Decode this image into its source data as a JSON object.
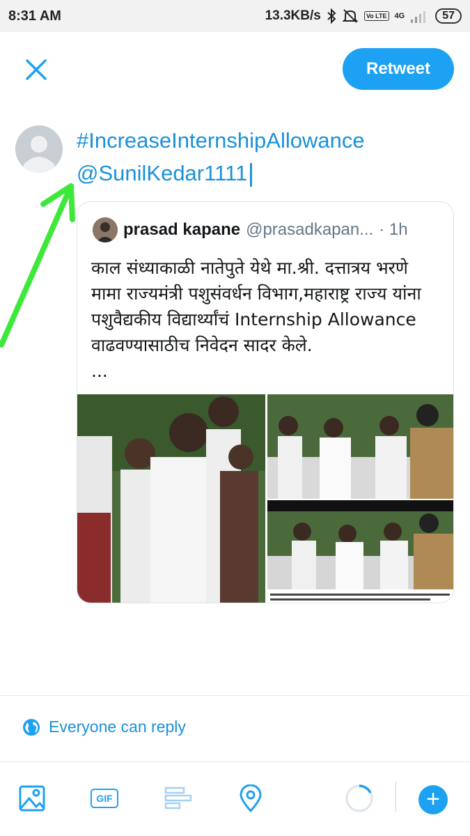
{
  "status_bar": {
    "time": "8:31 AM",
    "speed": "13.3KB/s",
    "network": "4G",
    "volte": "Vo LTE",
    "battery": "57"
  },
  "header": {
    "retweet_label": "Retweet"
  },
  "compose": {
    "hashtag": "#IncreaseInternshipAllowance",
    "mention": "@SunilKedar1111"
  },
  "quoted_tweet": {
    "name": "prasad kapane",
    "handle": "@prasadkapan...",
    "time": "· 1h",
    "text": "काल संध्याकाळी नातेपुते येथे मा.श्री. दत्तात्रय भरणे मामा राज्यमंत्री पशुसंवर्धन विभाग,महाराष्ट्र राज्य यांना पशुवैद्यकीय विद्यार्थ्यांचं Internship Allowance वाढवण्यासाठीच निवेदन सादर केले.",
    "ellipsis": "..."
  },
  "footer": {
    "reply_setting": "Everyone can reply"
  },
  "toolbar": {
    "gif_label": "GIF",
    "add_label": "+"
  },
  "colors": {
    "accent": "#1da1f2",
    "arrow": "#3ee83a"
  }
}
